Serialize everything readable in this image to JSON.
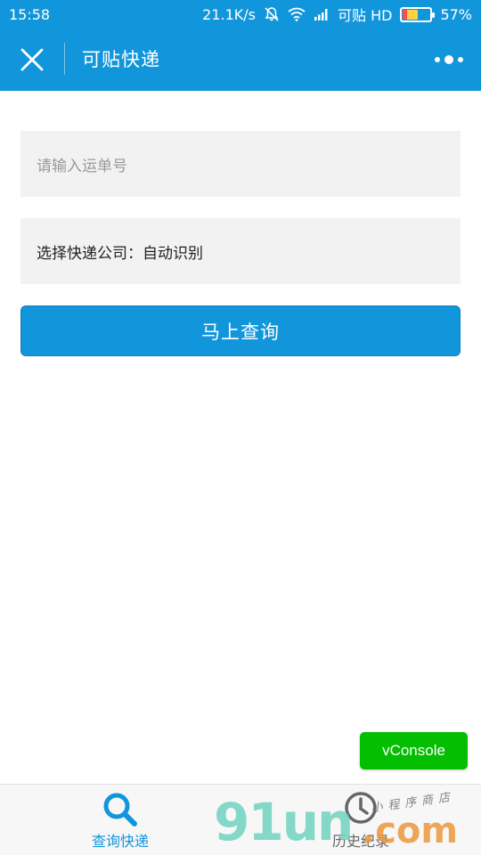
{
  "status_bar": {
    "time": "15:58",
    "network_speed": "21.1K/s",
    "carrier": "可贴 HD",
    "battery_percent": "57%",
    "battery_level": 0.57,
    "icons": [
      "bell-off-icon",
      "wifi-icon",
      "signal-icon",
      "battery-icon"
    ]
  },
  "nav_bar": {
    "title": "可贴快递",
    "close_icon": "close-icon",
    "more_icon": "more-dots-icon"
  },
  "form": {
    "waybill_input": {
      "placeholder": "请输入运单号",
      "value": ""
    },
    "company_select": {
      "label": "选择快递公司：",
      "value": "自动识别"
    },
    "query_button_label": "马上查询"
  },
  "vconsole": {
    "label": "vConsole"
  },
  "tab_bar": {
    "tabs": [
      {
        "label": "查询快递",
        "icon": "search-icon",
        "active": true
      },
      {
        "label": "历史纪录",
        "icon": "clock-icon",
        "active": false
      }
    ]
  },
  "watermark": {
    "main": "91un",
    "suffix": ".com",
    "sub": "小程序商店"
  },
  "colors": {
    "brand": "#1296db",
    "vconsole": "#04be02",
    "field_bg": "#f2f2f2"
  }
}
